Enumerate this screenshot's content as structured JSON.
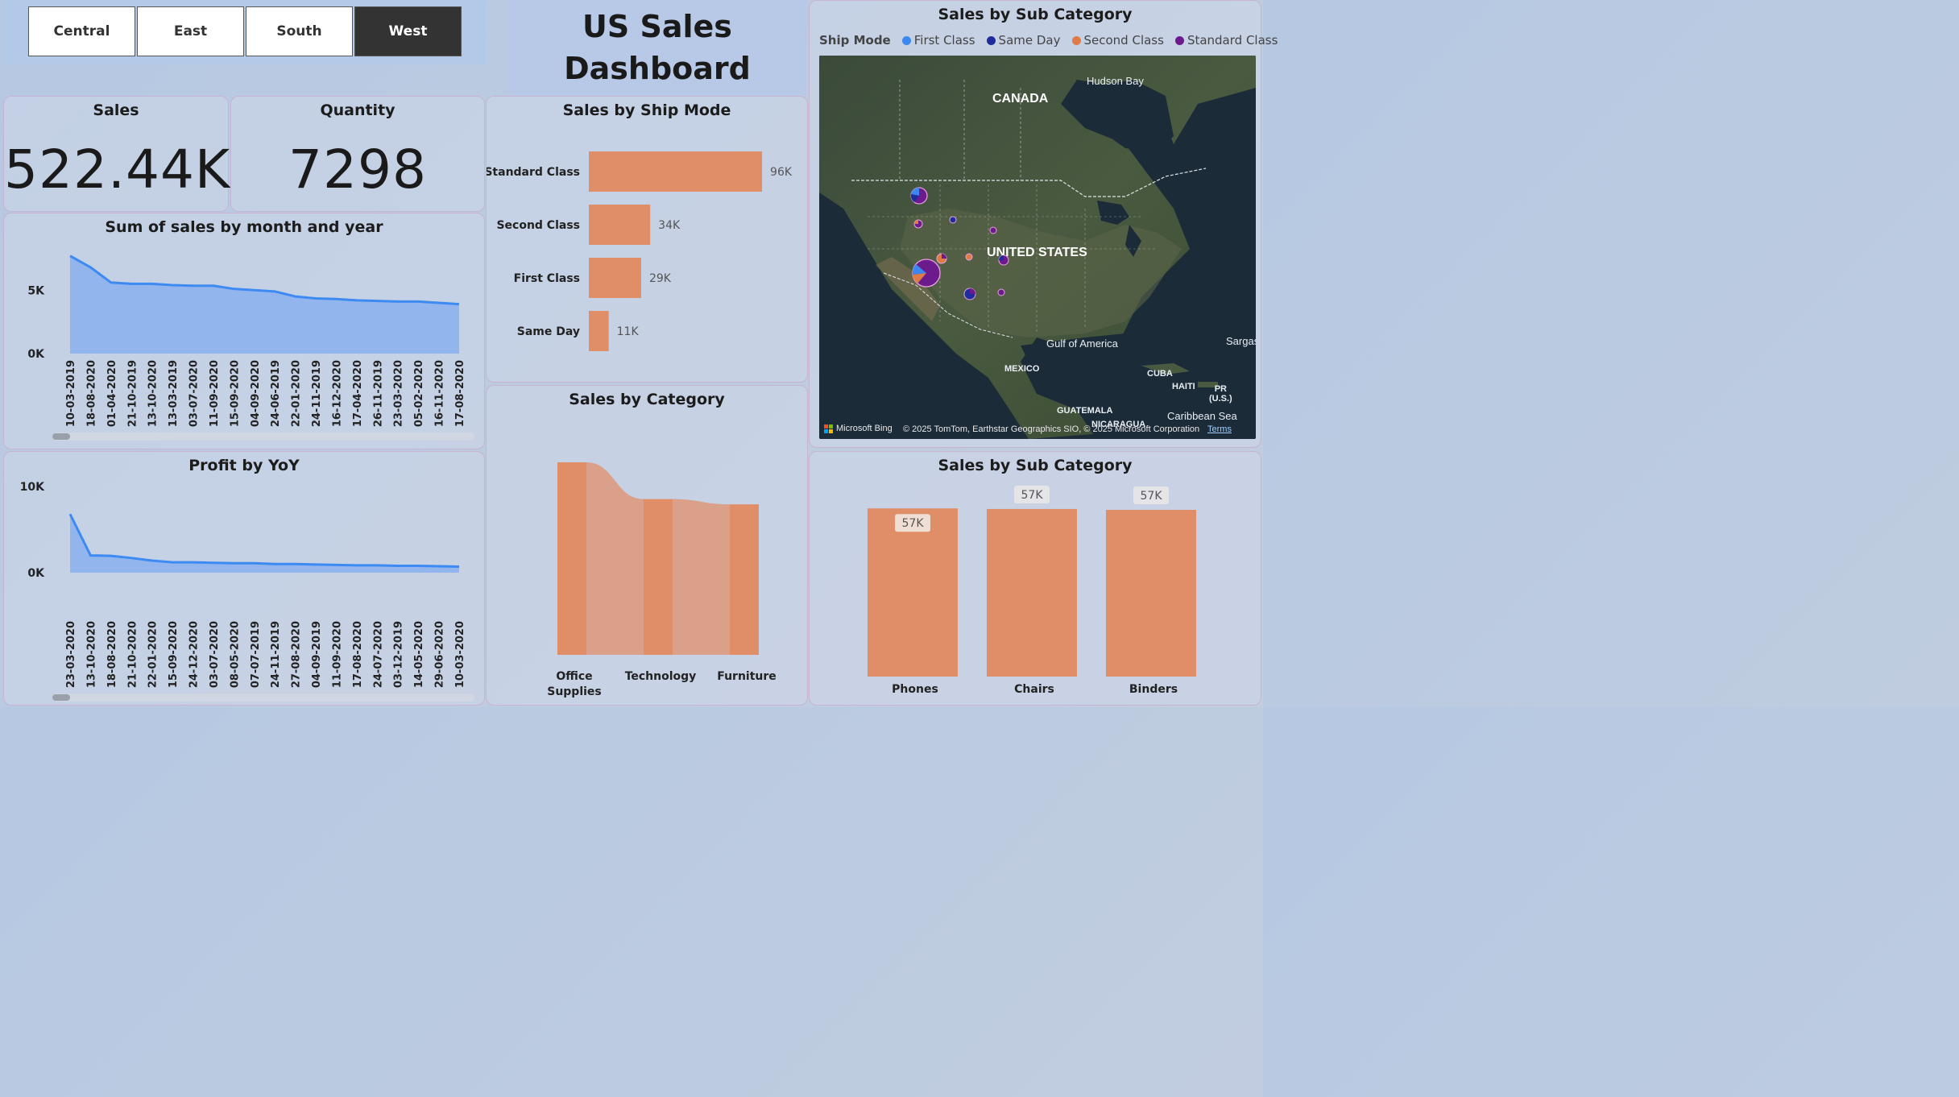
{
  "slicer": {
    "items": [
      "Central",
      "East",
      "South",
      "West"
    ],
    "active": "West"
  },
  "dashboard": {
    "title_line1": "US Sales",
    "title_line2": "Dashboard"
  },
  "cards": {
    "sales": {
      "label": "Sales",
      "value": "522.44K"
    },
    "quantity": {
      "label": "Quantity",
      "value": "7298"
    }
  },
  "colors": {
    "area_fill": "#8fb3ee",
    "line": "#3d8af2",
    "bar": "#e08e68",
    "bar_light": "#dba08a",
    "first_class": "#3c87f0",
    "same_day": "#1e2d9e",
    "second_class": "#e07b45",
    "standard_class": "#6b1b8c"
  },
  "sales_month": {
    "title": "Sum of sales by month and year",
    "chart_data": {
      "type": "area",
      "x": [
        "10-03-2019",
        "18-08-2020",
        "01-04-2020",
        "21-10-2019",
        "13-10-2020",
        "13-03-2019",
        "03-07-2020",
        "11-09-2020",
        "15-09-2020",
        "04-09-2020",
        "24-06-2019",
        "22-01-2020",
        "24-11-2019",
        "16-12-2020",
        "17-04-2020",
        "26-11-2019",
        "23-03-2020",
        "05-02-2020",
        "16-11-2020",
        "17-08-2020"
      ],
      "values": [
        7700,
        6800,
        5600,
        5500,
        5500,
        5400,
        5350,
        5350,
        5100,
        5000,
        4900,
        4500,
        4350,
        4300,
        4200,
        4150,
        4100,
        4100,
        4000,
        3900
      ],
      "y_ticks": [
        "0K",
        "5K"
      ],
      "ylim": [
        0,
        8000
      ]
    }
  },
  "profit_yoy": {
    "title": "Profit by YoY",
    "chart_data": {
      "type": "area",
      "x": [
        "23-03-2020",
        "13-10-2020",
        "18-08-2020",
        "21-10-2020",
        "22-01-2020",
        "15-09-2020",
        "24-12-2020",
        "03-07-2020",
        "08-05-2020",
        "07-07-2019",
        "24-11-2019",
        "27-08-2020",
        "04-09-2019",
        "11-09-2020",
        "17-08-2020",
        "24-07-2020",
        "03-12-2019",
        "14-05-2020",
        "29-06-2020",
        "10-03-2020"
      ],
      "values": [
        6800,
        2000,
        1950,
        1700,
        1400,
        1200,
        1200,
        1150,
        1100,
        1100,
        1000,
        1000,
        950,
        900,
        850,
        850,
        800,
        800,
        750,
        700
      ],
      "y_ticks": [
        "0K",
        "10K"
      ],
      "ylim": [
        0,
        10000
      ]
    }
  },
  "ship_mode": {
    "title": "Sales by Ship Mode",
    "chart_data": {
      "type": "bar",
      "categories": [
        "Standard Class",
        "Second Class",
        "First Class",
        "Same Day"
      ],
      "values": [
        96000,
        34000,
        29000,
        11000
      ],
      "labels": [
        "96K",
        "34K",
        "29K",
        "11K"
      ],
      "xlim": [
        0,
        100000
      ]
    }
  },
  "category": {
    "title": "Sales by Category",
    "chart_data": {
      "type": "bar",
      "categories": [
        "Office Supplies",
        "Technology",
        "Furniture"
      ],
      "values": [
        220000,
        178000,
        172000
      ],
      "ylim": [
        0,
        220000
      ]
    }
  },
  "map": {
    "title": "Sales by Sub Category",
    "legend_title": "Ship Mode",
    "legend": [
      "First Class",
      "Same Day",
      "Second Class",
      "Standard Class"
    ],
    "labels": {
      "hudson": "Hudson Bay",
      "canada": "CANADA",
      "us": "UNITED STATES",
      "gulf": "Gulf of America",
      "mexico": "MEXICO",
      "cuba": "CUBA",
      "haiti": "HAITI",
      "pr": "PR\n(U.S.)",
      "guatemala": "GUATEMALA",
      "nicaragua": "NICARAGUA",
      "caribbean": "Caribbean Sea",
      "sargas": "Sargas"
    },
    "brand": "Microsoft Bing",
    "copyright": "© 2025 TomTom, Earthstar Geographics SIO, © 2025 Microsoft Corporation",
    "terms": "Terms"
  },
  "subcat": {
    "title": "Sales by Sub Category",
    "chart_data": {
      "type": "bar",
      "categories": [
        "Phones",
        "Chairs",
        "Binders"
      ],
      "values": [
        57200,
        57000,
        56700
      ],
      "labels": [
        "57K",
        "57K",
        "57K"
      ],
      "ylim": [
        0,
        60000
      ]
    }
  }
}
